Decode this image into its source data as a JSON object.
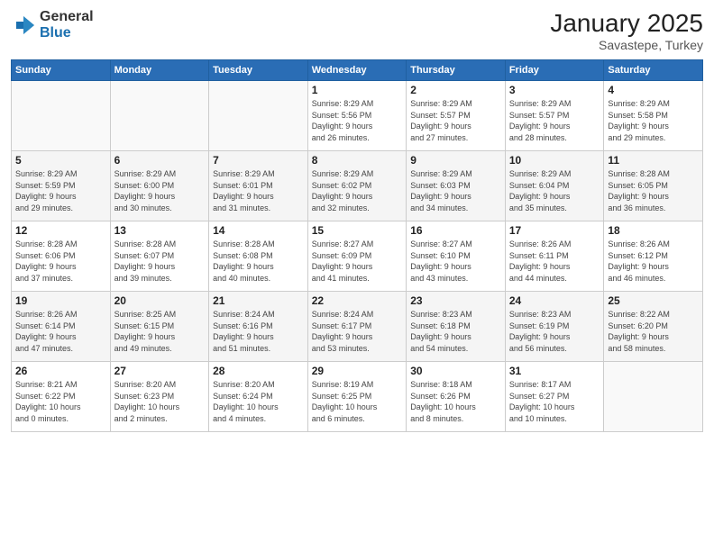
{
  "logo": {
    "general": "General",
    "blue": "Blue"
  },
  "title": "January 2025",
  "location": "Savastepe, Turkey",
  "weekdays": [
    "Sunday",
    "Monday",
    "Tuesday",
    "Wednesday",
    "Thursday",
    "Friday",
    "Saturday"
  ],
  "weeks": [
    [
      {
        "day": "",
        "info": ""
      },
      {
        "day": "",
        "info": ""
      },
      {
        "day": "",
        "info": ""
      },
      {
        "day": "1",
        "info": "Sunrise: 8:29 AM\nSunset: 5:56 PM\nDaylight: 9 hours\nand 26 minutes."
      },
      {
        "day": "2",
        "info": "Sunrise: 8:29 AM\nSunset: 5:57 PM\nDaylight: 9 hours\nand 27 minutes."
      },
      {
        "day": "3",
        "info": "Sunrise: 8:29 AM\nSunset: 5:57 PM\nDaylight: 9 hours\nand 28 minutes."
      },
      {
        "day": "4",
        "info": "Sunrise: 8:29 AM\nSunset: 5:58 PM\nDaylight: 9 hours\nand 29 minutes."
      }
    ],
    [
      {
        "day": "5",
        "info": "Sunrise: 8:29 AM\nSunset: 5:59 PM\nDaylight: 9 hours\nand 29 minutes."
      },
      {
        "day": "6",
        "info": "Sunrise: 8:29 AM\nSunset: 6:00 PM\nDaylight: 9 hours\nand 30 minutes."
      },
      {
        "day": "7",
        "info": "Sunrise: 8:29 AM\nSunset: 6:01 PM\nDaylight: 9 hours\nand 31 minutes."
      },
      {
        "day": "8",
        "info": "Sunrise: 8:29 AM\nSunset: 6:02 PM\nDaylight: 9 hours\nand 32 minutes."
      },
      {
        "day": "9",
        "info": "Sunrise: 8:29 AM\nSunset: 6:03 PM\nDaylight: 9 hours\nand 34 minutes."
      },
      {
        "day": "10",
        "info": "Sunrise: 8:29 AM\nSunset: 6:04 PM\nDaylight: 9 hours\nand 35 minutes."
      },
      {
        "day": "11",
        "info": "Sunrise: 8:28 AM\nSunset: 6:05 PM\nDaylight: 9 hours\nand 36 minutes."
      }
    ],
    [
      {
        "day": "12",
        "info": "Sunrise: 8:28 AM\nSunset: 6:06 PM\nDaylight: 9 hours\nand 37 minutes."
      },
      {
        "day": "13",
        "info": "Sunrise: 8:28 AM\nSunset: 6:07 PM\nDaylight: 9 hours\nand 39 minutes."
      },
      {
        "day": "14",
        "info": "Sunrise: 8:28 AM\nSunset: 6:08 PM\nDaylight: 9 hours\nand 40 minutes."
      },
      {
        "day": "15",
        "info": "Sunrise: 8:27 AM\nSunset: 6:09 PM\nDaylight: 9 hours\nand 41 minutes."
      },
      {
        "day": "16",
        "info": "Sunrise: 8:27 AM\nSunset: 6:10 PM\nDaylight: 9 hours\nand 43 minutes."
      },
      {
        "day": "17",
        "info": "Sunrise: 8:26 AM\nSunset: 6:11 PM\nDaylight: 9 hours\nand 44 minutes."
      },
      {
        "day": "18",
        "info": "Sunrise: 8:26 AM\nSunset: 6:12 PM\nDaylight: 9 hours\nand 46 minutes."
      }
    ],
    [
      {
        "day": "19",
        "info": "Sunrise: 8:26 AM\nSunset: 6:14 PM\nDaylight: 9 hours\nand 47 minutes."
      },
      {
        "day": "20",
        "info": "Sunrise: 8:25 AM\nSunset: 6:15 PM\nDaylight: 9 hours\nand 49 minutes."
      },
      {
        "day": "21",
        "info": "Sunrise: 8:24 AM\nSunset: 6:16 PM\nDaylight: 9 hours\nand 51 minutes."
      },
      {
        "day": "22",
        "info": "Sunrise: 8:24 AM\nSunset: 6:17 PM\nDaylight: 9 hours\nand 53 minutes."
      },
      {
        "day": "23",
        "info": "Sunrise: 8:23 AM\nSunset: 6:18 PM\nDaylight: 9 hours\nand 54 minutes."
      },
      {
        "day": "24",
        "info": "Sunrise: 8:23 AM\nSunset: 6:19 PM\nDaylight: 9 hours\nand 56 minutes."
      },
      {
        "day": "25",
        "info": "Sunrise: 8:22 AM\nSunset: 6:20 PM\nDaylight: 9 hours\nand 58 minutes."
      }
    ],
    [
      {
        "day": "26",
        "info": "Sunrise: 8:21 AM\nSunset: 6:22 PM\nDaylight: 10 hours\nand 0 minutes."
      },
      {
        "day": "27",
        "info": "Sunrise: 8:20 AM\nSunset: 6:23 PM\nDaylight: 10 hours\nand 2 minutes."
      },
      {
        "day": "28",
        "info": "Sunrise: 8:20 AM\nSunset: 6:24 PM\nDaylight: 10 hours\nand 4 minutes."
      },
      {
        "day": "29",
        "info": "Sunrise: 8:19 AM\nSunset: 6:25 PM\nDaylight: 10 hours\nand 6 minutes."
      },
      {
        "day": "30",
        "info": "Sunrise: 8:18 AM\nSunset: 6:26 PM\nDaylight: 10 hours\nand 8 minutes."
      },
      {
        "day": "31",
        "info": "Sunrise: 8:17 AM\nSunset: 6:27 PM\nDaylight: 10 hours\nand 10 minutes."
      },
      {
        "day": "",
        "info": ""
      }
    ]
  ]
}
